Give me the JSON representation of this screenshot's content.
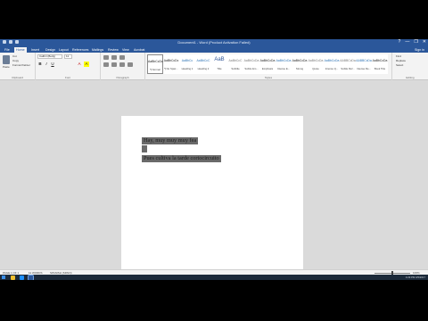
{
  "window": {
    "title": "Document1 - Word (Product Activation Failed)",
    "controls": [
      "?",
      "—",
      "❐",
      "✕"
    ]
  },
  "tabs": [
    {
      "label": "File"
    },
    {
      "label": "Home"
    },
    {
      "label": "Insert"
    },
    {
      "label": "Design"
    },
    {
      "label": "Layout"
    },
    {
      "label": "References"
    },
    {
      "label": "Mailings"
    },
    {
      "label": "Review"
    },
    {
      "label": "View"
    },
    {
      "label": "Acrobat"
    }
  ],
  "signin_label": "Sign in",
  "ribbon": {
    "clipboard": {
      "group_label": "Clipboard",
      "paste_label": "Paste",
      "cut_label": "Cut",
      "copy_label": "Copy",
      "format_painter_label": "Format Painter"
    },
    "font": {
      "group_label": "Font",
      "font_name": "Calibri (Body)",
      "font_size": "11",
      "buttons": [
        "B",
        "I",
        "U",
        "A",
        "A"
      ]
    },
    "paragraph": {
      "group_label": "Paragraph"
    },
    "styles": {
      "group_label": "Styles",
      "items": [
        {
          "sample": "AaBbCcDc",
          "name": "¶ Normal",
          "kind": "normal"
        },
        {
          "sample": "AaBbCcDc",
          "name": "¶ No Spac...",
          "kind": "normal"
        },
        {
          "sample": "AaBbCc",
          "name": "Heading 1",
          "kind": "heading"
        },
        {
          "sample": "AaBbCcC",
          "name": "Heading 2",
          "kind": "heading"
        },
        {
          "sample": "AaB",
          "name": "Title",
          "kind": "big"
        },
        {
          "sample": "AaBbCcC",
          "name": "Subtitle",
          "kind": "subtle"
        },
        {
          "sample": "AaBbCcDa",
          "name": "Subtle Em...",
          "kind": "subtle"
        },
        {
          "sample": "AaBbCcDa",
          "name": "Emphasis",
          "kind": "normal"
        },
        {
          "sample": "AaBbCcDa",
          "name": "Intense E...",
          "kind": "heading"
        },
        {
          "sample": "AaBbCcDa",
          "name": "Strong",
          "kind": "normal"
        },
        {
          "sample": "AaBbCcDa",
          "name": "Quote",
          "kind": "subtle"
        },
        {
          "sample": "AaBbCcDa",
          "name": "Intense Q...",
          "kind": "heading"
        },
        {
          "sample": "AABBCcDa",
          "name": "Subtle Ref...",
          "kind": "subtle"
        },
        {
          "sample": "AABBCcDa",
          "name": "Intense Re...",
          "kind": "heading"
        },
        {
          "sample": "AaBbCcDa",
          "name": "Book Title",
          "kind": "normal"
        }
      ]
    },
    "editing": {
      "group_label": "Editing",
      "find_label": "Find",
      "replace_label": "Replace",
      "select_label": "Select"
    }
  },
  "document": {
    "lines": [
      "Hay, muy muy muy fea",
      "Pues cultiva la tarde cortocircuito"
    ]
  },
  "statusbar": {
    "page": "PAGE 1 OF 1",
    "words": "11 WORDS",
    "language": "SPANISH (SPAIN)",
    "zoom": "100%"
  },
  "taskbar": {
    "time": "4:29 PM",
    "date": "3/5/2017"
  },
  "colors": {
    "accent": "#2b579a",
    "highlight": "#6a6a6a",
    "background": "#dadada"
  }
}
